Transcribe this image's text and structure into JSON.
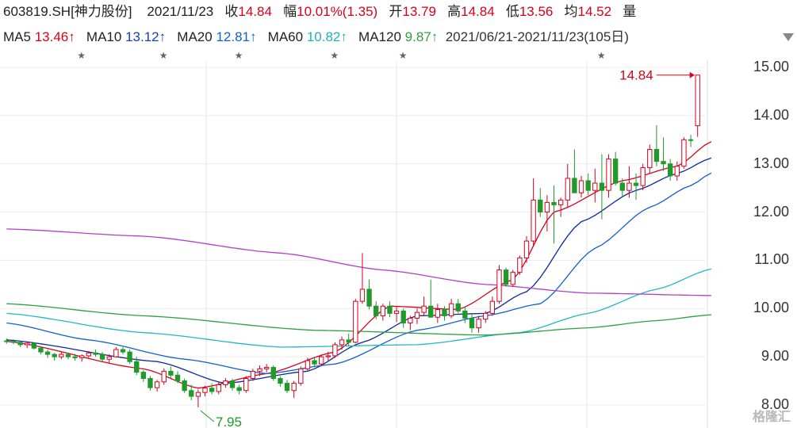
{
  "header": {
    "code": "603819.SH[神力股份]",
    "date": "2021/11/23",
    "close_label": "收",
    "close": "14.84",
    "amp_label": "幅",
    "amp": "10.01%(1.35)",
    "open_label": "开",
    "open": "13.79",
    "high_label": "高",
    "high": "14.84",
    "low_label": "低",
    "low": "13.56",
    "avg_label": "均",
    "avg": "14.52",
    "vol_label": "量"
  },
  "ma_legend": {
    "ma5_label": "MA5",
    "ma5": "13.46↑",
    "ma10_label": "MA10",
    "ma10": "13.12↑",
    "ma20_label": "MA20",
    "ma20": "12.81↑",
    "ma60_label": "MA60",
    "ma60": "10.82↑",
    "ma120_label": "MA120",
    "ma120": "9.87↑",
    "range": "2021/06/21-2021/11/23(105日)"
  },
  "colors": {
    "up": "#d9001b",
    "down": "#1f9a2b",
    "ma5": "#d9001b",
    "ma10": "#0a2a9e",
    "ma20": "#1060d0",
    "ma60": "#20b8c8",
    "ma120": "#2ea040",
    "ma250": "#b040c8"
  },
  "watermark": "格隆汇",
  "chart_data": {
    "type": "candlestick",
    "ylim": [
      8.0,
      15.0
    ],
    "yticks": [
      "8.00",
      "9.00",
      "10.00",
      "11.00",
      "12.00",
      "13.00",
      "14.00",
      "15.00"
    ],
    "annotations": [
      {
        "text": "14.84",
        "value": 14.84,
        "kind": "max"
      },
      {
        "text": "7.95",
        "value": 7.95,
        "kind": "min"
      }
    ],
    "star_markers": 6,
    "candles_ohlc": [
      [
        9.33,
        9.38,
        9.27,
        9.32
      ],
      [
        9.32,
        9.36,
        9.26,
        9.3
      ],
      [
        9.3,
        9.33,
        9.2,
        9.25
      ],
      [
        9.25,
        9.3,
        9.18,
        9.28
      ],
      [
        9.28,
        9.3,
        9.15,
        9.18
      ],
      [
        9.18,
        9.22,
        9.05,
        9.1
      ],
      [
        9.1,
        9.15,
        8.98,
        9.05
      ],
      [
        9.05,
        9.08,
        8.92,
        9.0
      ],
      [
        9.0,
        9.1,
        8.95,
        9.05
      ],
      [
        9.05,
        9.08,
        8.95,
        9.0
      ],
      [
        9.0,
        9.06,
        8.92,
        8.98
      ],
      [
        8.98,
        9.05,
        8.9,
        9.02
      ],
      [
        9.02,
        9.12,
        8.98,
        9.08
      ],
      [
        9.08,
        9.15,
        9.0,
        9.05
      ],
      [
        9.05,
        9.1,
        8.9,
        8.95
      ],
      [
        8.95,
        9.05,
        8.88,
        9.0
      ],
      [
        9.0,
        9.2,
        8.98,
        9.15
      ],
      [
        9.15,
        9.2,
        9.05,
        9.1
      ],
      [
        9.1,
        9.15,
        8.85,
        8.9
      ],
      [
        8.9,
        9.0,
        8.62,
        8.68
      ],
      [
        8.68,
        8.72,
        8.48,
        8.55
      ],
      [
        8.55,
        8.6,
        8.3,
        8.36
      ],
      [
        8.36,
        8.52,
        8.28,
        8.48
      ],
      [
        8.48,
        8.76,
        8.42,
        8.7
      ],
      [
        8.7,
        8.8,
        8.56,
        8.62
      ],
      [
        8.62,
        8.7,
        8.45,
        8.5
      ],
      [
        8.5,
        8.55,
        8.25,
        8.3
      ],
      [
        8.3,
        8.42,
        8.1,
        8.18
      ],
      [
        8.18,
        8.32,
        7.95,
        8.26
      ],
      [
        8.26,
        8.4,
        8.18,
        8.35
      ],
      [
        8.35,
        8.45,
        8.22,
        8.28
      ],
      [
        8.28,
        8.48,
        8.22,
        8.42
      ],
      [
        8.42,
        8.56,
        8.36,
        8.5
      ],
      [
        8.5,
        8.55,
        8.3,
        8.36
      ],
      [
        8.36,
        8.42,
        8.22,
        8.3
      ],
      [
        8.3,
        8.6,
        8.25,
        8.55
      ],
      [
        8.55,
        8.75,
        8.5,
        8.7
      ],
      [
        8.7,
        8.82,
        8.6,
        8.75
      ],
      [
        8.75,
        8.85,
        8.68,
        8.78
      ],
      [
        8.78,
        8.82,
        8.5,
        8.55
      ],
      [
        8.55,
        8.6,
        8.38,
        8.45
      ],
      [
        8.45,
        8.52,
        8.25,
        8.3
      ],
      [
        8.3,
        8.5,
        8.15,
        8.45
      ],
      [
        8.45,
        8.8,
        8.4,
        8.75
      ],
      [
        8.75,
        8.98,
        8.7,
        8.92
      ],
      [
        8.92,
        9.0,
        8.78,
        8.85
      ],
      [
        8.85,
        9.05,
        8.8,
        9.0
      ],
      [
        9.0,
        9.1,
        8.9,
        9.02
      ],
      [
        9.02,
        9.3,
        8.98,
        9.25
      ],
      [
        9.25,
        9.42,
        9.15,
        9.35
      ],
      [
        9.35,
        9.48,
        9.22,
        9.3
      ],
      [
        9.3,
        10.2,
        9.28,
        10.15
      ],
      [
        10.15,
        11.15,
        10.1,
        10.4
      ],
      [
        10.4,
        10.6,
        9.98,
        10.05
      ],
      [
        10.05,
        10.15,
        9.78,
        9.85
      ],
      [
        9.85,
        10.1,
        9.75,
        10.05
      ],
      [
        10.05,
        10.15,
        9.82,
        9.9
      ],
      [
        9.9,
        10.05,
        9.72,
        9.95
      ],
      [
        9.95,
        10.0,
        9.6,
        9.7
      ],
      [
        9.7,
        9.85,
        9.55,
        9.8
      ],
      [
        9.8,
        10.0,
        9.68,
        9.92
      ],
      [
        9.92,
        10.25,
        9.85,
        10.05
      ],
      [
        10.05,
        10.6,
        9.9,
        9.82
      ],
      [
        9.82,
        10.1,
        9.7,
        9.98
      ],
      [
        9.98,
        10.05,
        9.75,
        9.85
      ],
      [
        9.85,
        10.2,
        9.8,
        10.1
      ],
      [
        10.1,
        10.2,
        9.9,
        9.95
      ],
      [
        9.95,
        10.05,
        9.7,
        9.8
      ],
      [
        9.8,
        9.9,
        9.5,
        9.6
      ],
      [
        9.6,
        9.85,
        9.5,
        9.78
      ],
      [
        9.78,
        9.95,
        9.7,
        9.9
      ],
      [
        9.9,
        10.25,
        9.85,
        10.15
      ],
      [
        10.15,
        10.9,
        10.1,
        10.8
      ],
      [
        10.8,
        10.85,
        10.45,
        10.5
      ],
      [
        10.5,
        10.8,
        10.45,
        10.75
      ],
      [
        10.75,
        11.1,
        10.7,
        11.05
      ],
      [
        11.05,
        11.5,
        10.95,
        11.4
      ],
      [
        11.4,
        12.7,
        11.3,
        12.25
      ],
      [
        12.25,
        12.5,
        11.9,
        12.0
      ],
      [
        12.0,
        12.35,
        11.6,
        12.2
      ],
      [
        12.2,
        12.55,
        11.35,
        12.15
      ],
      [
        12.15,
        12.3,
        11.9,
        12.25
      ],
      [
        12.25,
        13.0,
        12.1,
        12.7
      ],
      [
        12.7,
        13.3,
        12.5,
        12.4
      ],
      [
        12.4,
        12.75,
        12.3,
        12.65
      ],
      [
        12.65,
        12.8,
        12.35,
        12.45
      ],
      [
        12.45,
        12.9,
        12.2,
        12.6
      ],
      [
        12.6,
        13.2,
        11.85,
        12.45
      ],
      [
        12.45,
        13.2,
        12.3,
        13.1
      ],
      [
        13.1,
        13.25,
        12.55,
        12.6
      ],
      [
        12.6,
        12.7,
        12.3,
        12.45
      ],
      [
        12.45,
        12.95,
        12.3,
        12.6
      ],
      [
        12.6,
        12.8,
        12.25,
        12.55
      ],
      [
        12.55,
        13.0,
        12.45,
        12.92
      ],
      [
        12.92,
        13.4,
        12.8,
        13.3
      ],
      [
        13.3,
        13.8,
        12.95,
        13.05
      ],
      [
        13.05,
        13.55,
        12.85,
        13.0
      ],
      [
        13.0,
        13.1,
        12.65,
        12.75
      ],
      [
        12.75,
        13.05,
        12.65,
        12.95
      ],
      [
        12.95,
        13.55,
        12.9,
        13.5
      ],
      [
        13.5,
        13.6,
        13.35,
        13.49
      ],
      [
        13.79,
        14.84,
        13.56,
        14.84
      ]
    ],
    "ma_series": [
      {
        "name": "MA5",
        "color_key": "ma5",
        "keys": [
          [
            0,
            9.32
          ],
          [
            20,
            8.75
          ],
          [
            28,
            8.35
          ],
          [
            38,
            8.65
          ],
          [
            48,
            9.1
          ],
          [
            56,
            10.05
          ],
          [
            66,
            9.98
          ],
          [
            74,
            10.6
          ],
          [
            80,
            12.0
          ],
          [
            90,
            12.65
          ],
          [
            98,
            12.95
          ],
          [
            103,
            13.46
          ]
        ]
      },
      {
        "name": "MA10",
        "color_key": "ma10",
        "keys": [
          [
            0,
            9.35
          ],
          [
            22,
            8.9
          ],
          [
            32,
            8.45
          ],
          [
            44,
            8.7
          ],
          [
            52,
            9.3
          ],
          [
            60,
            9.85
          ],
          [
            70,
            9.9
          ],
          [
            76,
            10.35
          ],
          [
            84,
            11.8
          ],
          [
            92,
            12.45
          ],
          [
            98,
            12.8
          ],
          [
            103,
            13.12
          ]
        ]
      },
      {
        "name": "MA20",
        "color_key": "ma20",
        "keys": [
          [
            0,
            9.7
          ],
          [
            12,
            9.35
          ],
          [
            26,
            8.95
          ],
          [
            38,
            8.65
          ],
          [
            48,
            8.85
          ],
          [
            60,
            9.55
          ],
          [
            70,
            9.85
          ],
          [
            78,
            10.1
          ],
          [
            86,
            11.25
          ],
          [
            94,
            12.1
          ],
          [
            100,
            12.55
          ],
          [
            103,
            12.81
          ]
        ]
      },
      {
        "name": "MA60",
        "color_key": "ma60",
        "keys": [
          [
            0,
            9.9
          ],
          [
            20,
            9.5
          ],
          [
            40,
            9.2
          ],
          [
            60,
            9.25
          ],
          [
            75,
            9.5
          ],
          [
            85,
            9.9
          ],
          [
            95,
            10.4
          ],
          [
            103,
            10.82
          ]
        ]
      },
      {
        "name": "MA120",
        "color_key": "ma120",
        "keys": [
          [
            0,
            10.1
          ],
          [
            20,
            9.85
          ],
          [
            45,
            9.55
          ],
          [
            70,
            9.45
          ],
          [
            85,
            9.6
          ],
          [
            95,
            9.75
          ],
          [
            103,
            9.87
          ]
        ]
      },
      {
        "name": "MA250",
        "color_key": "ma250",
        "keys": [
          [
            0,
            11.65
          ],
          [
            20,
            11.5
          ],
          [
            40,
            11.15
          ],
          [
            55,
            10.8
          ],
          [
            70,
            10.5
          ],
          [
            85,
            10.32
          ],
          [
            103,
            10.27
          ]
        ]
      }
    ]
  }
}
